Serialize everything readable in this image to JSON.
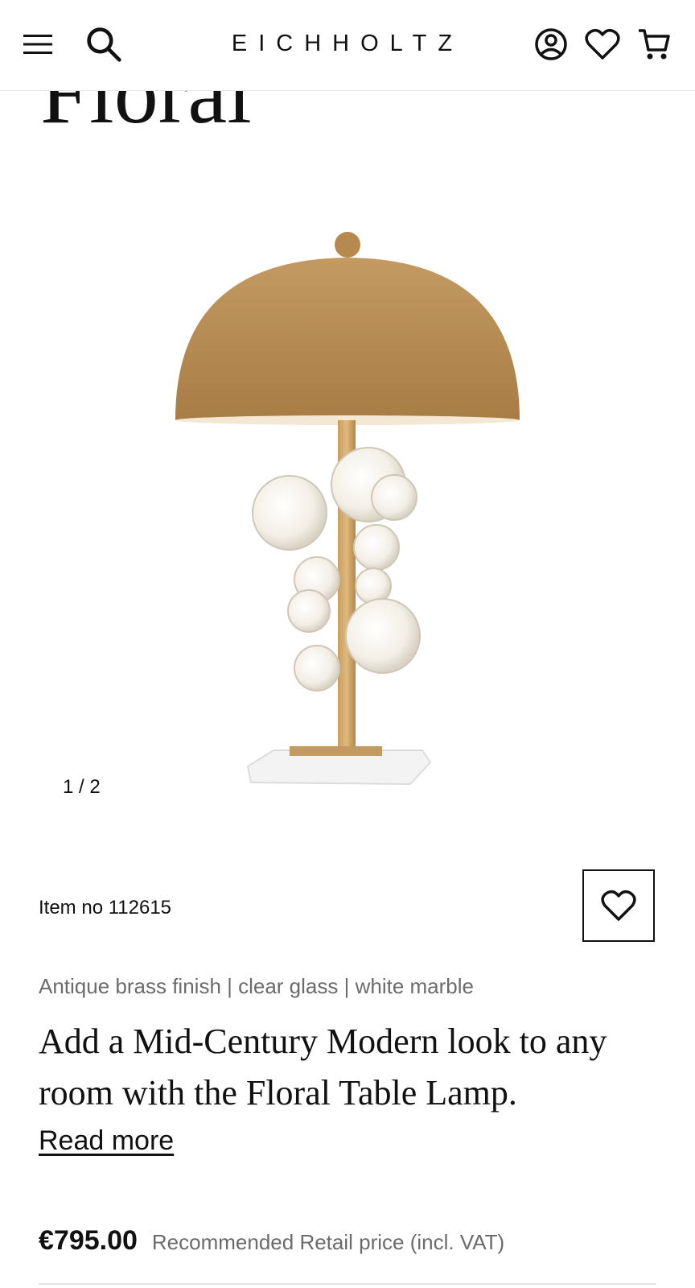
{
  "header": {
    "brand": "EICHHOLTZ",
    "icons": [
      "menu-icon",
      "search-icon",
      "account-icon",
      "heart-icon",
      "cart-icon"
    ]
  },
  "product": {
    "title_fragment": "Floral",
    "gallery_counter": "1 / 2",
    "item_no": "Item no 112615",
    "materials": "Antique brass finish | clear glass | white marble",
    "description": "Add a Mid-Century Modern look to any room with the Floral Table Lamp.",
    "read_more": "Read more",
    "price": "€795.00",
    "price_note": "Recommended Retail price (incl. VAT)"
  },
  "colors": {
    "brass": "#b8894f",
    "marble": "#f1f1f1",
    "text_muted": "#6b6b6b"
  }
}
